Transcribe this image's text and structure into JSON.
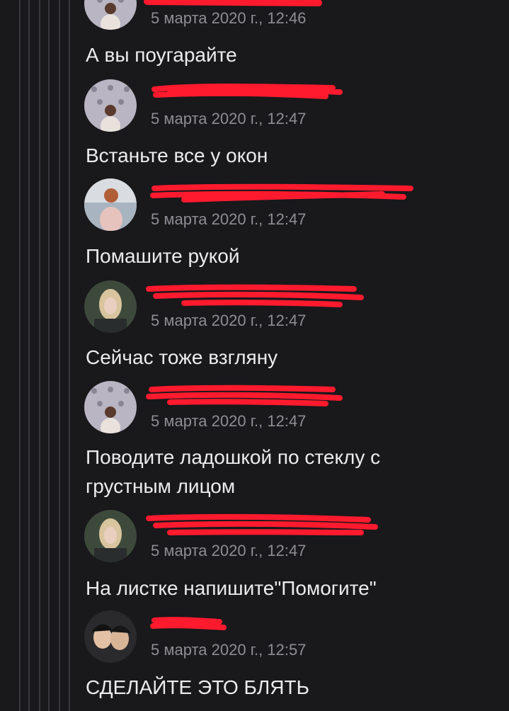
{
  "thread": {
    "comments": [
      {
        "author": "",
        "date": "5 марта 2020 г., 12:46",
        "text": "А вы поугарайте",
        "avatar": "wall-girl-avatar"
      },
      {
        "author": "",
        "date": "5 марта 2020 г., 12:47",
        "text": "Встаньте все у окон",
        "avatar": "wall-girl-avatar"
      },
      {
        "author": "",
        "date": "5 марта 2020 г., 12:47",
        "text": "Помашите рукой",
        "avatar": "beach-girl-avatar"
      },
      {
        "author": "",
        "date": "5 марта 2020 г., 12:47",
        "text": "Сейчас тоже взгляну",
        "avatar": "blonde-girl-avatar"
      },
      {
        "author": "",
        "date": "5 марта 2020 г., 12:47",
        "text": "Поводите ладошкой по стеклу с грустным лицом",
        "avatar": "wall-girl-avatar"
      },
      {
        "author": "",
        "date": "5 марта 2020 г., 12:47",
        "text": "На листке напишите\"Помогите\"",
        "avatar": "blonde-girl-avatar"
      },
      {
        "author": "",
        "date": "5 марта 2020 г., 12:57",
        "text": "СДЕЛАЙТЕ ЭТО БЛЯТЬ",
        "avatar": "two-people-avatar"
      }
    ]
  },
  "colors": {
    "background": "#19181b",
    "text": "#ececec",
    "date": "#8e8e93",
    "author_link": "#5a8bd6",
    "redaction": "#ff1a2e",
    "thread_line": "#38373b"
  }
}
